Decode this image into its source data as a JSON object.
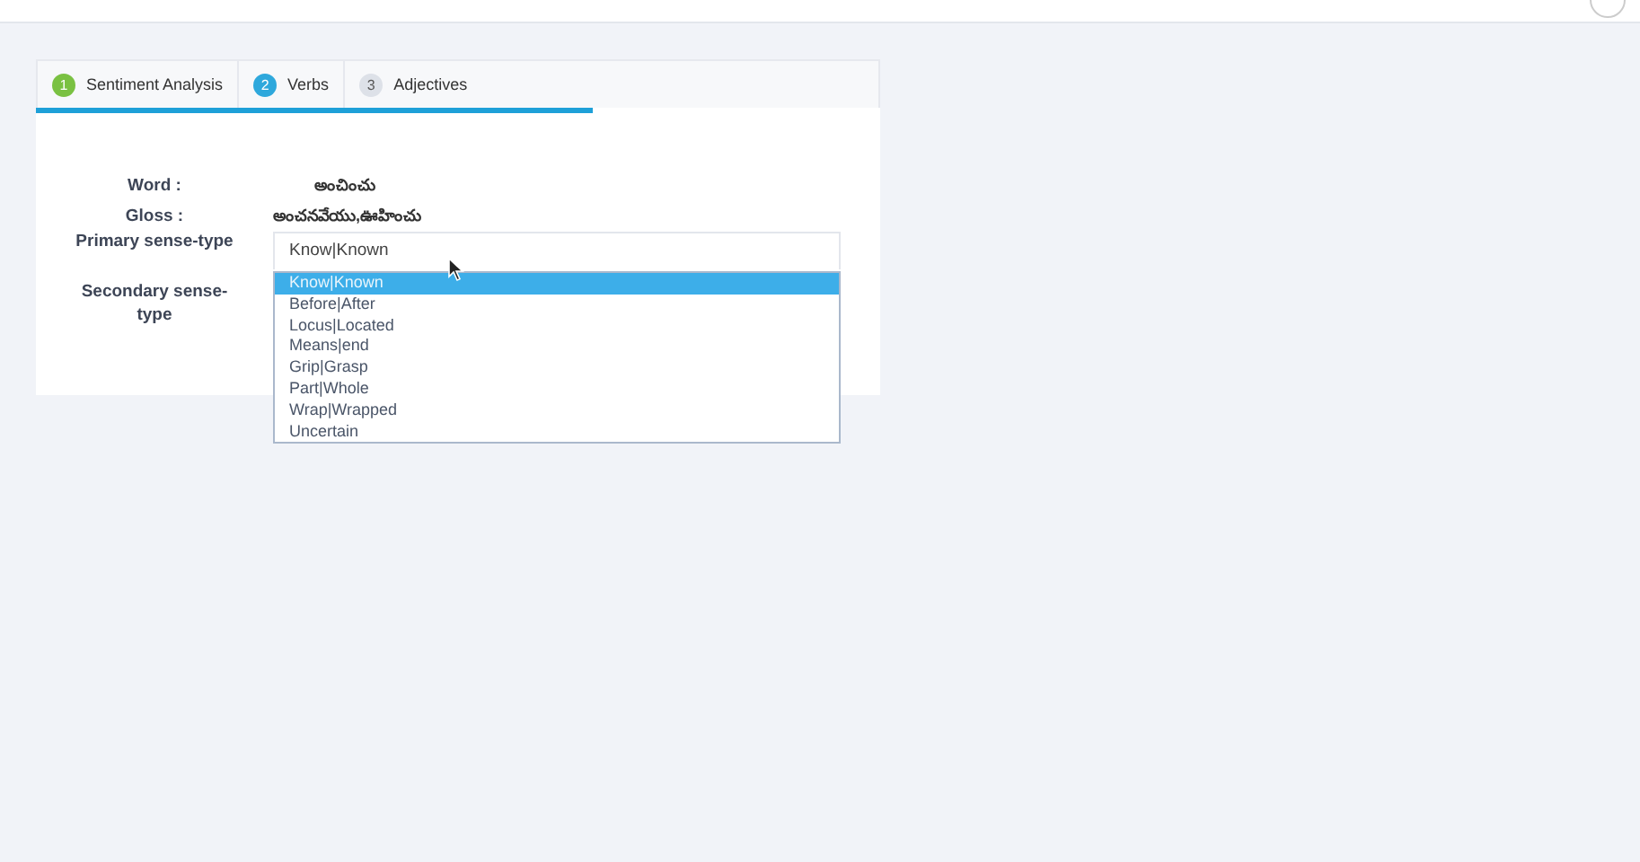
{
  "tabs": [
    {
      "number": "1",
      "label": "Sentiment Analysis",
      "color": "#7ac142"
    },
    {
      "number": "2",
      "label": "Verbs",
      "color": "#2ea8dc"
    },
    {
      "number": "3",
      "label": "Adjectives",
      "color": "#dde1e8"
    }
  ],
  "progress": {
    "level": 0.66
  },
  "fields": [
    {
      "label": "Word :",
      "value": "అంచించు"
    },
    {
      "label": "Gloss :",
      "value": "అంచనవేయు,ఊహించు"
    }
  ],
  "primary": {
    "label": "Primary sense-type",
    "value": "Know|Known",
    "expanded": true,
    "options": [
      {
        "label": "Know|Known",
        "selected": true
      },
      {
        "label": "Before|After",
        "selected": false
      },
      {
        "label": "Locus|Located",
        "selected": false
      },
      {
        "label": "Means|end",
        "selected": false
      },
      {
        "label": "Grip|Grasp",
        "selected": false
      },
      {
        "label": "Part|Whole",
        "selected": false
      },
      {
        "label": "Wrap|Wrapped",
        "selected": false
      },
      {
        "label": "Uncertain",
        "selected": false
      }
    ]
  },
  "secondary": {
    "label": "Secondary sense-type"
  }
}
